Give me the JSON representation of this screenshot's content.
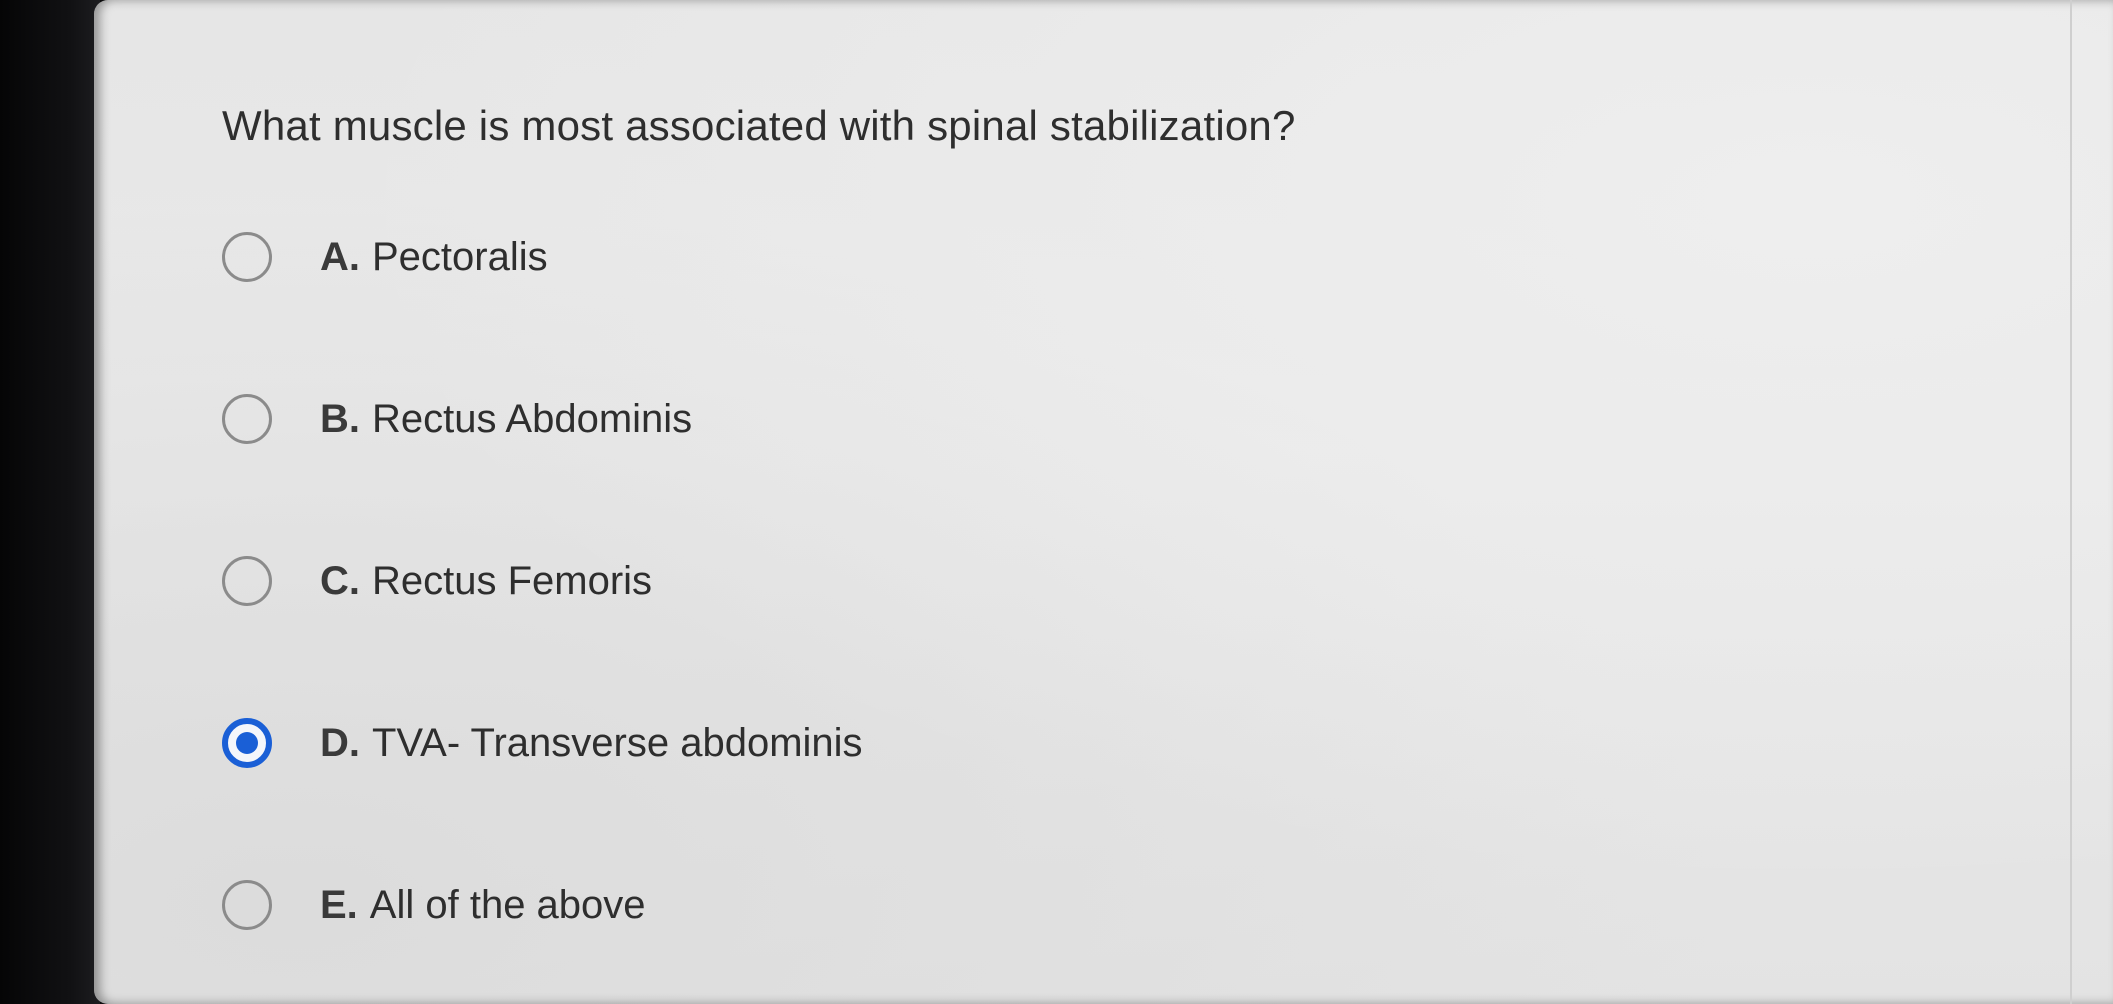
{
  "question": {
    "text": "What muscle is most associated with spinal stabilization?"
  },
  "options": [
    {
      "letter": "A.",
      "label": "Pectoralis",
      "selected": false
    },
    {
      "letter": "B.",
      "label": "Rectus Abdominis",
      "selected": false
    },
    {
      "letter": "C.",
      "label": "Rectus Femoris",
      "selected": false
    },
    {
      "letter": "D.",
      "label": "TVA- Transverse abdominis",
      "selected": true
    },
    {
      "letter": "E.",
      "label": "All of the above",
      "selected": false
    }
  ],
  "colors": {
    "accent": "#1a5fd6",
    "radio_border": "#8b8b8b",
    "text": "#2e2e2e"
  }
}
